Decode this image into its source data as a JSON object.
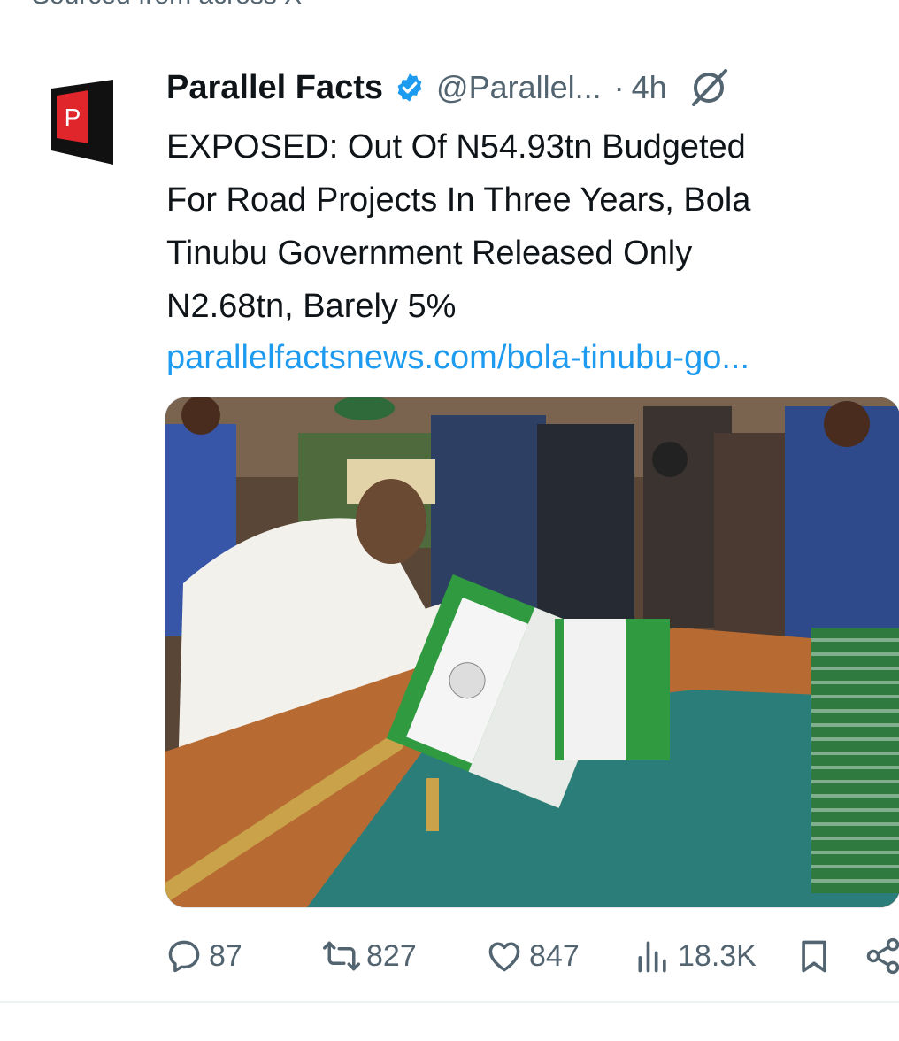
{
  "top_clip": "Sourced from across X",
  "post": {
    "author_name": "Parallel Facts",
    "handle": "@Parallel...",
    "separator": "·",
    "time": "4h",
    "text_lines": [
      "EXPOSED: Out Of N54.93tn Budgeted",
      "For Road Projects In Three Years, Bola",
      "Tinubu Government Released Only",
      "N2.68tn, Barely 5%"
    ],
    "link": "parallelfactsnews.com/bola-tinubu-go..."
  },
  "avatar": {
    "letter": "P",
    "colors": {
      "black": "#111111",
      "red": "#e0262b"
    }
  },
  "actions": {
    "replies": "87",
    "reposts": "827",
    "likes": "847",
    "views": "18.3K"
  },
  "colors": {
    "text": "#0f1419",
    "secondary": "#536471",
    "link": "#1d9bf0",
    "verified": "#1d9bf0"
  },
  "icons": [
    "verified-badge-icon",
    "grok-icon",
    "reply-icon",
    "repost-icon",
    "like-icon",
    "views-icon",
    "bookmark-icon",
    "share-icon"
  ]
}
